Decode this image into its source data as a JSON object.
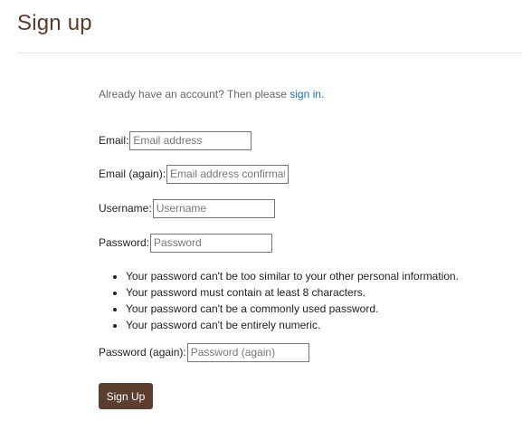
{
  "page": {
    "title": "Sign up"
  },
  "intro": {
    "text": "Already have an account? Then please ",
    "link_text": "sign in",
    "suffix": "."
  },
  "form": {
    "email": {
      "label": "Email:",
      "placeholder": "Email address",
      "value": ""
    },
    "email_again": {
      "label": "Email (again):",
      "placeholder": "Email address confirmation",
      "value": ""
    },
    "username": {
      "label": "Username:",
      "placeholder": "Username",
      "value": ""
    },
    "password": {
      "label": "Password:",
      "placeholder": "Password",
      "value": ""
    },
    "password_help": [
      "Your password can't be too similar to your other personal information.",
      "Your password must contain at least 8 characters.",
      "Your password can't be a commonly used password.",
      "Your password can't be entirely numeric."
    ],
    "password_again": {
      "label": "Password (again):",
      "placeholder": "Password (again)",
      "value": ""
    },
    "submit_label": "Sign Up"
  },
  "colors": {
    "title": "#5a3a2a",
    "link": "#1a73b8",
    "button_bg": "#5b3e30",
    "button_text": "#ffffff"
  }
}
